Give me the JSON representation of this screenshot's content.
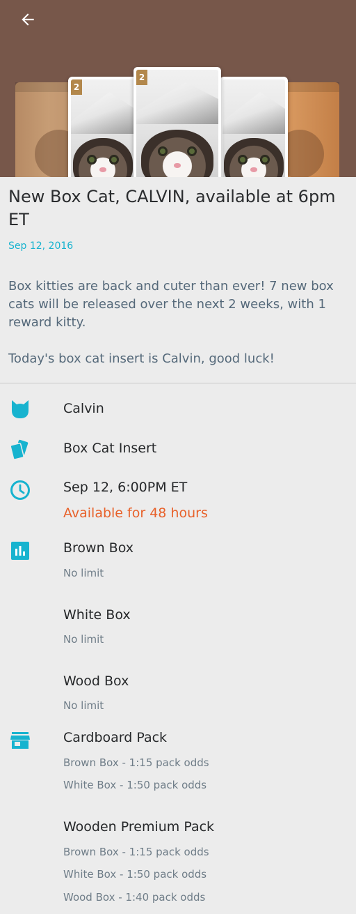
{
  "colors": {
    "header_bg": "#77574a",
    "accent": "#17b3cf",
    "warning": "#e8612a",
    "background": "#ececec"
  },
  "header": {
    "back_icon": "arrow-left-icon",
    "card_badges": [
      "2",
      "2"
    ]
  },
  "article": {
    "title": "New Box Cat, CALVIN, available at 6pm ET",
    "date": "Sep 12, 2016",
    "paragraph_1": "Box kitties are back and cuter than ever! 7 new box cats will be released over the next 2 weeks, with 1 reward kitty.",
    "paragraph_2": "Today's box cat insert is Calvin, good luck!"
  },
  "details": {
    "character": {
      "icon": "cat-icon",
      "label": "Calvin"
    },
    "card_type": {
      "icon": "cards-icon",
      "label": "Box Cat Insert"
    },
    "release": {
      "icon": "clock-icon",
      "label": "Sep 12, 6:00PM ET",
      "availability": "Available for 48 hours"
    },
    "variants": {
      "icon": "bar-chart-icon",
      "items": [
        {
          "name": "Brown Box",
          "limit": "No limit"
        },
        {
          "name": "White Box",
          "limit": "No limit"
        },
        {
          "name": "Wood Box",
          "limit": "No limit"
        }
      ]
    },
    "packs": {
      "icon": "store-icon",
      "items": [
        {
          "name": "Cardboard Pack",
          "odds": [
            "Brown Box - 1:15 pack odds",
            "White Box - 1:50 pack odds"
          ]
        },
        {
          "name": "Wooden Premium Pack",
          "odds": [
            "Brown Box - 1:15 pack odds",
            "White Box - 1:50 pack odds",
            "Wood Box - 1:40 pack odds"
          ]
        }
      ]
    }
  }
}
